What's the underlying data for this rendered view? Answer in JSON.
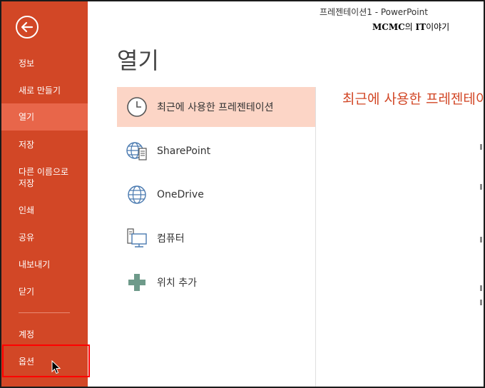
{
  "window": {
    "title": "프레젠테이션1 - PowerPoint",
    "watermark_strong": "MCMC",
    "watermark_mid": "의 ",
    "watermark_strong2": "IT",
    "watermark_end": "이야기"
  },
  "sidebar": {
    "items": [
      {
        "label": "정보"
      },
      {
        "label": "새로 만들기"
      },
      {
        "label": "열기"
      },
      {
        "label": "저장"
      },
      {
        "label": "다른 이름으로"
      },
      {
        "label": "저장"
      },
      {
        "label": "인쇄"
      },
      {
        "label": "공유"
      },
      {
        "label": "내보내기"
      },
      {
        "label": "닫기"
      },
      {
        "label": "계정"
      },
      {
        "label": "옵션"
      }
    ],
    "accent": "#d24726",
    "active_color": "#e8664a"
  },
  "main": {
    "title": "열기",
    "locations": [
      {
        "label": "최근에 사용한 프레젠테이션",
        "icon": "clock-icon"
      },
      {
        "label": "SharePoint",
        "icon": "sharepoint-icon"
      },
      {
        "label": "OneDrive",
        "icon": "globe-icon"
      },
      {
        "label": "컴퓨터",
        "icon": "computer-icon"
      },
      {
        "label": "위치 추가",
        "icon": "plus-icon"
      }
    ],
    "recent_heading": "최근에 사용한 프레젠테이션"
  }
}
